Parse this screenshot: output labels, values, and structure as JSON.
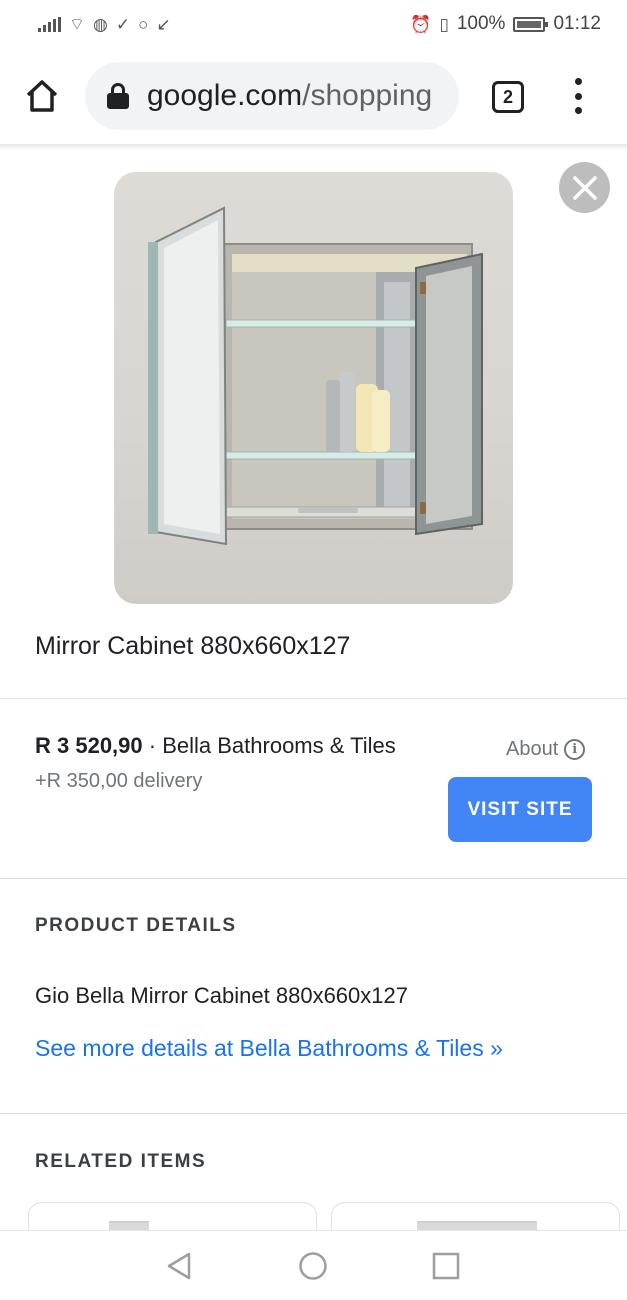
{
  "status_bar": {
    "battery": "100%",
    "time": "01:12"
  },
  "browser": {
    "url_domain": "google.com",
    "url_path": "/shopping",
    "tab_count": "2"
  },
  "product": {
    "title": "Mirror Cabinet 880x660x127",
    "price": "R 3 520,90",
    "separator": "·",
    "seller": "Bella Bathrooms & Tiles",
    "delivery": "+R 350,00 delivery",
    "about_label": "About",
    "visit_button": "VISIT SITE"
  },
  "details": {
    "heading": "PRODUCT DETAILS",
    "description": "Gio Bella Mirror Cabinet 880x660x127",
    "link": "See more details at Bella Bathrooms & Tiles »"
  },
  "related": {
    "heading": "RELATED ITEMS"
  },
  "colors": {
    "accent": "#4285f4",
    "link": "#1a73e8",
    "close_button": "#bdbdbd"
  },
  "icons": [
    "home-icon",
    "lock-icon",
    "tabs-icon",
    "more-vert-icon",
    "close-icon",
    "info-icon",
    "back-icon",
    "home-circle-icon",
    "recents-icon"
  ]
}
